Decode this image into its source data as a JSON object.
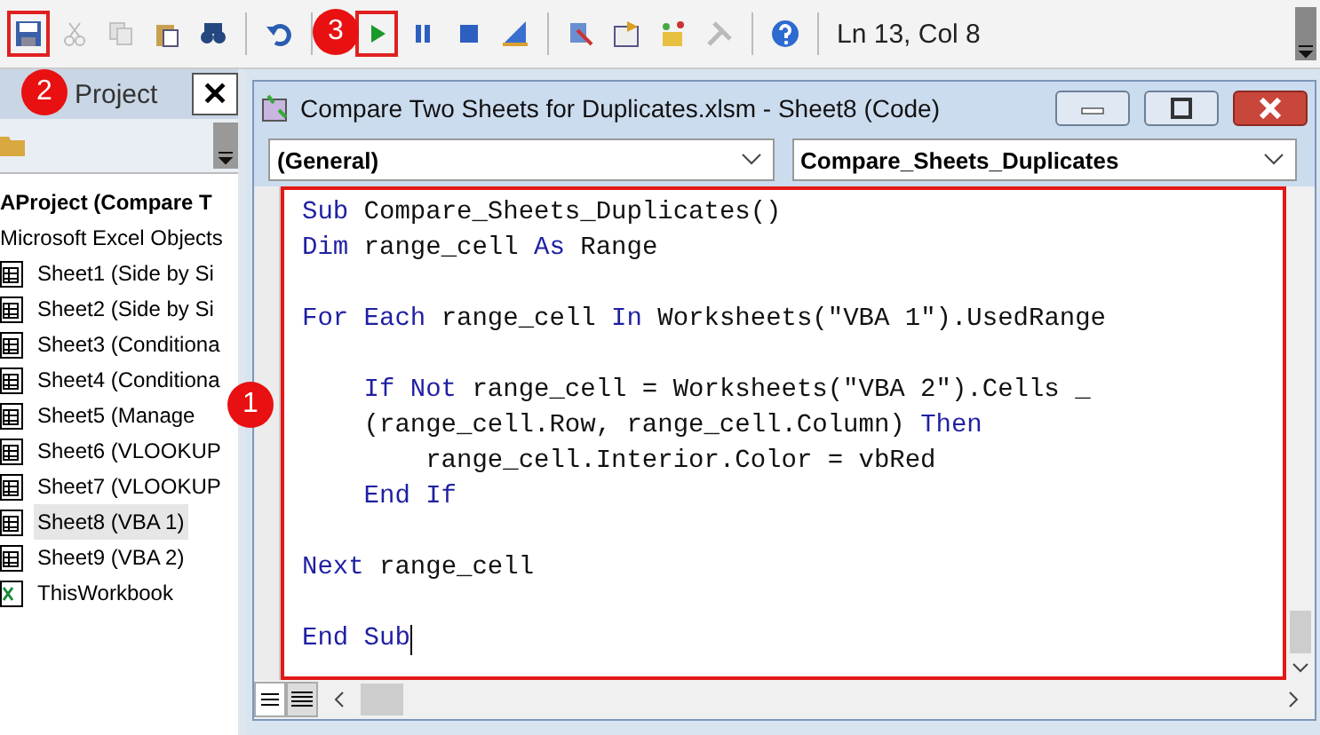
{
  "toolbar": {
    "status": "Ln 13, Col 8",
    "groups": [
      [
        {
          "disabled": false,
          "highlighted": true
        },
        {
          "disabled": true,
          "highlighted": false
        },
        {
          "disabled": true,
          "highlighted": false
        },
        {
          "disabled": false,
          "highlighted": false
        },
        {
          "disabled": false,
          "highlighted": false
        }
      ],
      [
        {
          "disabled": false,
          "highlighted": false
        }
      ],
      [
        {
          "disabled": false,
          "highlighted": true
        },
        {
          "disabled": false,
          "highlighted": false
        },
        {
          "disabled": false,
          "highlighted": false
        },
        {
          "disabled": false,
          "highlighted": false
        }
      ],
      [
        {
          "disabled": false,
          "highlighted": false
        },
        {
          "disabled": false,
          "highlighted": false
        },
        {
          "disabled": false,
          "highlighted": false
        },
        {
          "disabled": true,
          "highlighted": false
        }
      ],
      [
        {
          "disabled": false,
          "highlighted": false
        }
      ]
    ]
  },
  "project_panel": {
    "title": "Project",
    "close": "✕",
    "root": "AProject (Compare T",
    "children": [
      {
        "label": "Microsoft Excel Objects",
        "children": [
          {
            "label": "Sheet1 (Side by Si",
            "kind": "sheet",
            "selected": false
          },
          {
            "label": "Sheet2 (Side by Si",
            "kind": "sheet",
            "selected": false
          },
          {
            "label": "Sheet3 (Conditiona",
            "kind": "sheet",
            "selected": false
          },
          {
            "label": "Sheet4 (Conditiona",
            "kind": "sheet",
            "selected": false
          },
          {
            "label": "Sheet5 (Manage",
            "kind": "sheet",
            "selected": false
          },
          {
            "label": "Sheet6 (VLOOKUP",
            "kind": "sheet",
            "selected": false
          },
          {
            "label": "Sheet7 (VLOOKUP",
            "kind": "sheet",
            "selected": false
          },
          {
            "label": "Sheet8 (VBA 1)",
            "kind": "sheet",
            "selected": true
          },
          {
            "label": "Sheet9 (VBA 2)",
            "kind": "sheet",
            "selected": false
          },
          {
            "label": "ThisWorkbook",
            "kind": "workbook",
            "selected": false
          }
        ]
      }
    ]
  },
  "code_window": {
    "title": "Compare Two Sheets for Duplicates.xlsm - Sheet8 (Code)",
    "object_dropdown": "(General)",
    "procedure_dropdown": "Compare_Sheets_Duplicates",
    "highlighted": true,
    "lines": [
      {
        "kind": "code",
        "tokens": [
          {
            "text": "Sub",
            "kind": "keyword"
          },
          {
            "text": " Compare_Sheets_Duplicates()",
            "kind": "plain"
          }
        ]
      },
      {
        "kind": "code",
        "tokens": [
          {
            "text": "Dim",
            "kind": "keyword"
          },
          {
            "text": " range_cell ",
            "kind": "plain"
          },
          {
            "text": "As",
            "kind": "keyword"
          },
          {
            "text": " Range",
            "kind": "plain"
          }
        ]
      },
      {
        "kind": "blank"
      },
      {
        "kind": "code",
        "tokens": [
          {
            "text": "For Each",
            "kind": "keyword"
          },
          {
            "text": " range_cell ",
            "kind": "plain"
          },
          {
            "text": "In",
            "kind": "keyword"
          },
          {
            "text": " Worksheets(\"VBA 1\").UsedRange",
            "kind": "plain"
          }
        ],
        "children": [
          {
            "kind": "blank"
          },
          {
            "kind": "code",
            "tokens": [
              {
                "text": "If Not",
                "kind": "keyword"
              },
              {
                "text": " range_cell = Worksheets(\"VBA 2\").Cells _",
                "kind": "plain"
              }
            ]
          },
          {
            "kind": "code",
            "tokens": [
              {
                "text": "(range_cell.Row, range_cell.Column) ",
                "kind": "plain"
              },
              {
                "text": "Then",
                "kind": "keyword"
              }
            ],
            "children": [
              {
                "kind": "code",
                "tokens": [
                  {
                    "text": "range_cell.Interior.Color = vbRed",
                    "kind": "plain"
                  }
                ]
              }
            ]
          },
          {
            "kind": "code",
            "tokens": [
              {
                "text": "End If",
                "kind": "keyword"
              }
            ]
          }
        ]
      },
      {
        "kind": "blank"
      },
      {
        "kind": "code",
        "tokens": [
          {
            "text": "Next",
            "kind": "keyword"
          },
          {
            "text": " range_cell",
            "kind": "plain"
          }
        ]
      },
      {
        "kind": "blank"
      },
      {
        "kind": "code",
        "tokens": [
          {
            "text": "End Sub",
            "kind": "keyword"
          }
        ]
      }
    ]
  },
  "annotations": [
    "1",
    "2",
    "3"
  ]
}
